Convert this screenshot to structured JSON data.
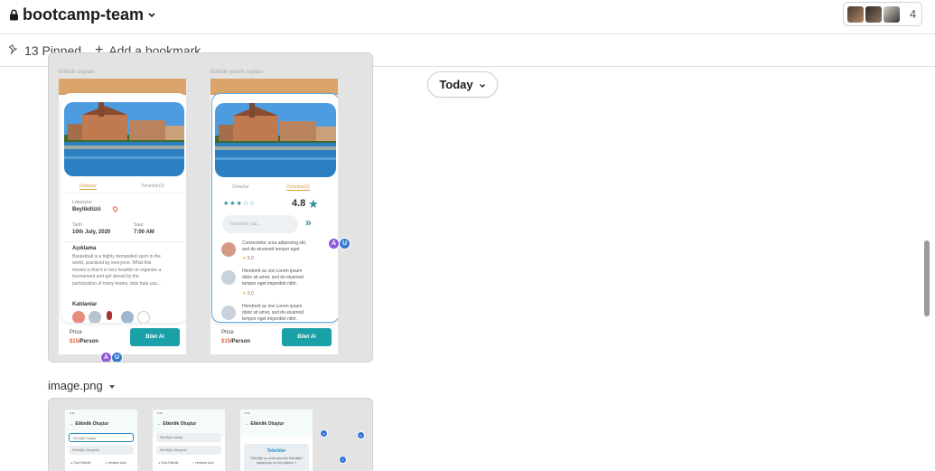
{
  "header": {
    "channel_name": "bootcamp-team",
    "member_count": "4"
  },
  "bookmarks": {
    "pinned_label": "13 Pinned",
    "add_label": "Add a bookmark"
  },
  "date_divider": {
    "label": "Today"
  },
  "attachment1": {
    "caption_left": "Etkinlik sayfası",
    "caption_right": "Etkinlik yorum sayfası",
    "left_screen": {
      "tab_details": "Detaylar",
      "tab_comments": "Yorumlar(3)",
      "location_label": "Lokasyon",
      "location": "Beylikdüzü",
      "date_label": "Tarih",
      "date": "10th July, 2020",
      "time_label": "Saat",
      "time": "7:00 AM",
      "desc_title": "Açıklama",
      "desc_lines": [
        "Basketball is a highly demanded sport in the",
        "world, practiced by everyone. What this",
        "means is that it is very feasible to organize a",
        "tournament and get ahead by the",
        "participation of many teams, dats hata yas..."
      ],
      "participants_title": "Katılanlar",
      "price_label": "Price",
      "price_amount": "$15",
      "price_unit": "/Person",
      "button": "Bilet Al"
    },
    "right_screen": {
      "tab_details": "Detaylar",
      "tab_comments": "Yorumlar(3)",
      "stars": "★★★☆☆",
      "rating": "4.8",
      "search_placeholder": "Yorumları yaz...",
      "comments": [
        {
          "lines": [
            "Consectetur urna adipiscing elit,",
            "sed do eiusmod tempor eget."
          ],
          "score": "5.0"
        },
        {
          "lines": [
            "Hendrerit ac nisi Lorem ipsum",
            "dolor sit amet, sed do eiusmod",
            "tempor eget imperdiet nibh."
          ],
          "score": "5.0"
        },
        {
          "lines": [
            "Hendrerit ac nisi Lorem ipsum",
            "dolor sit amet, sed do eiusmod",
            "tempor eget imperdiet nibh."
          ],
          "score": ""
        }
      ],
      "price_label": "Price",
      "price_amount": "$15",
      "price_unit": "/Person",
      "button": "Bilet Al"
    },
    "reactions": [
      "A",
      "U"
    ]
  },
  "attachment2": {
    "filename": "image.png",
    "screens": [
      {
        "title": "Etkinlik Oluştur",
        "field1": "Etkinliğin başlığı",
        "field2": "Etkinliğin kategorisi",
        "radio1": "Özel Etkinlik",
        "radio2": "Herkese Açık"
      },
      {
        "title": "Etkinlik Oluştur",
        "field1": "Etkinliğin başlığı",
        "field2": "Etkinliğin kategorisi",
        "radio1": "Özel Etkinlik",
        "radio2": "Herkese Açık"
      },
      {
        "title": "Etkinlik Oluştur",
        "tebrik_title": "Tebrikler",
        "tebrik_text": "Etkinliğin şu anda yayında! Etkinliğini paylaşmayı ve bol eğlence :)"
      }
    ],
    "dot_label": "U"
  },
  "colors": {
    "accent_orange": "#dba56a",
    "teal_button": "#1aa0a7",
    "reaction_a": "#8f5ad8",
    "reaction_u": "#3379cf"
  }
}
